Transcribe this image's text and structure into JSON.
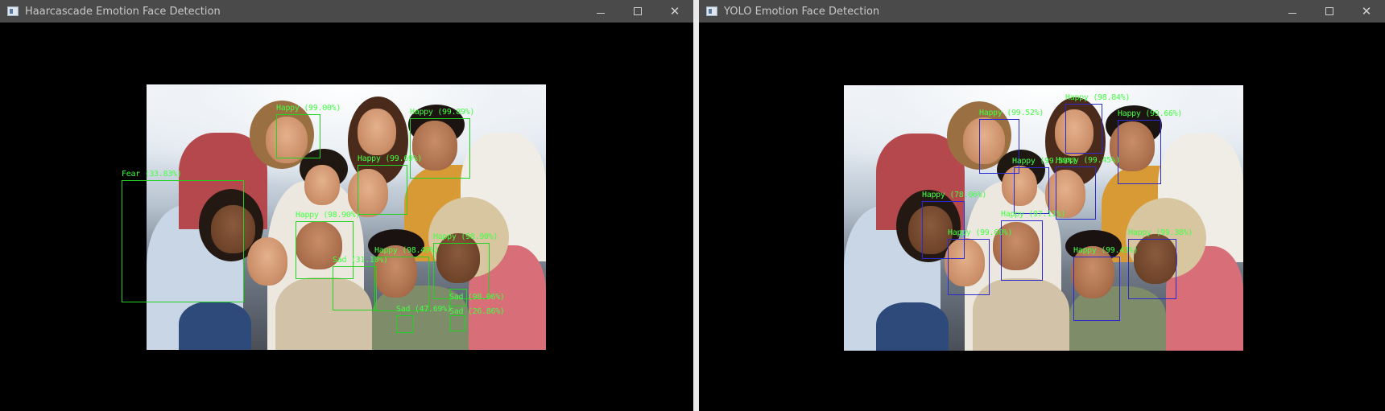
{
  "windows": [
    {
      "id": "left",
      "title": "Haarcascade Emotion Face Detection",
      "controls": {
        "minimize": "—",
        "maximize": "☐",
        "close": "✕"
      },
      "detections": [
        {
          "label": "Happy (99.00%)"
        },
        {
          "label": "Happy (99.89%)"
        },
        {
          "label": "Fear (33.83%)"
        },
        {
          "label": "Happy (99.69%)"
        },
        {
          "label": "Happy (98.90%)"
        },
        {
          "label": "Sad (31.10%)"
        },
        {
          "label": "Happy (98.49%)"
        },
        {
          "label": "Happy (98.90%)"
        },
        {
          "label": "Sad (98.06%)"
        },
        {
          "label": "Sad (47.69%)"
        },
        {
          "label": "Sad (26.86%)"
        }
      ]
    },
    {
      "id": "right",
      "title": "YOLO Emotion Face Detection",
      "controls": {
        "minimize": "—",
        "maximize": "☐",
        "close": "✕"
      },
      "detections": [
        {
          "label": "Happy (98.84%)"
        },
        {
          "label": "Happy (99.52%)"
        },
        {
          "label": "Happy (99.66%)"
        },
        {
          "label": "Happy (99.59%)"
        },
        {
          "label": "Happy (99.45%)"
        },
        {
          "label": "Happy (78.06%)"
        },
        {
          "label": "Happy (97.11%)"
        },
        {
          "label": "Happy (99.60%)"
        },
        {
          "label": "Happy (99.43%)"
        },
        {
          "label": "Happy (99.38%)"
        }
      ]
    }
  ],
  "colors": {
    "titlebar": "#4a4a4a",
    "haar_box": "#22d322",
    "yolo_box": "#2a2ad0",
    "label_text": "#44ff44"
  }
}
